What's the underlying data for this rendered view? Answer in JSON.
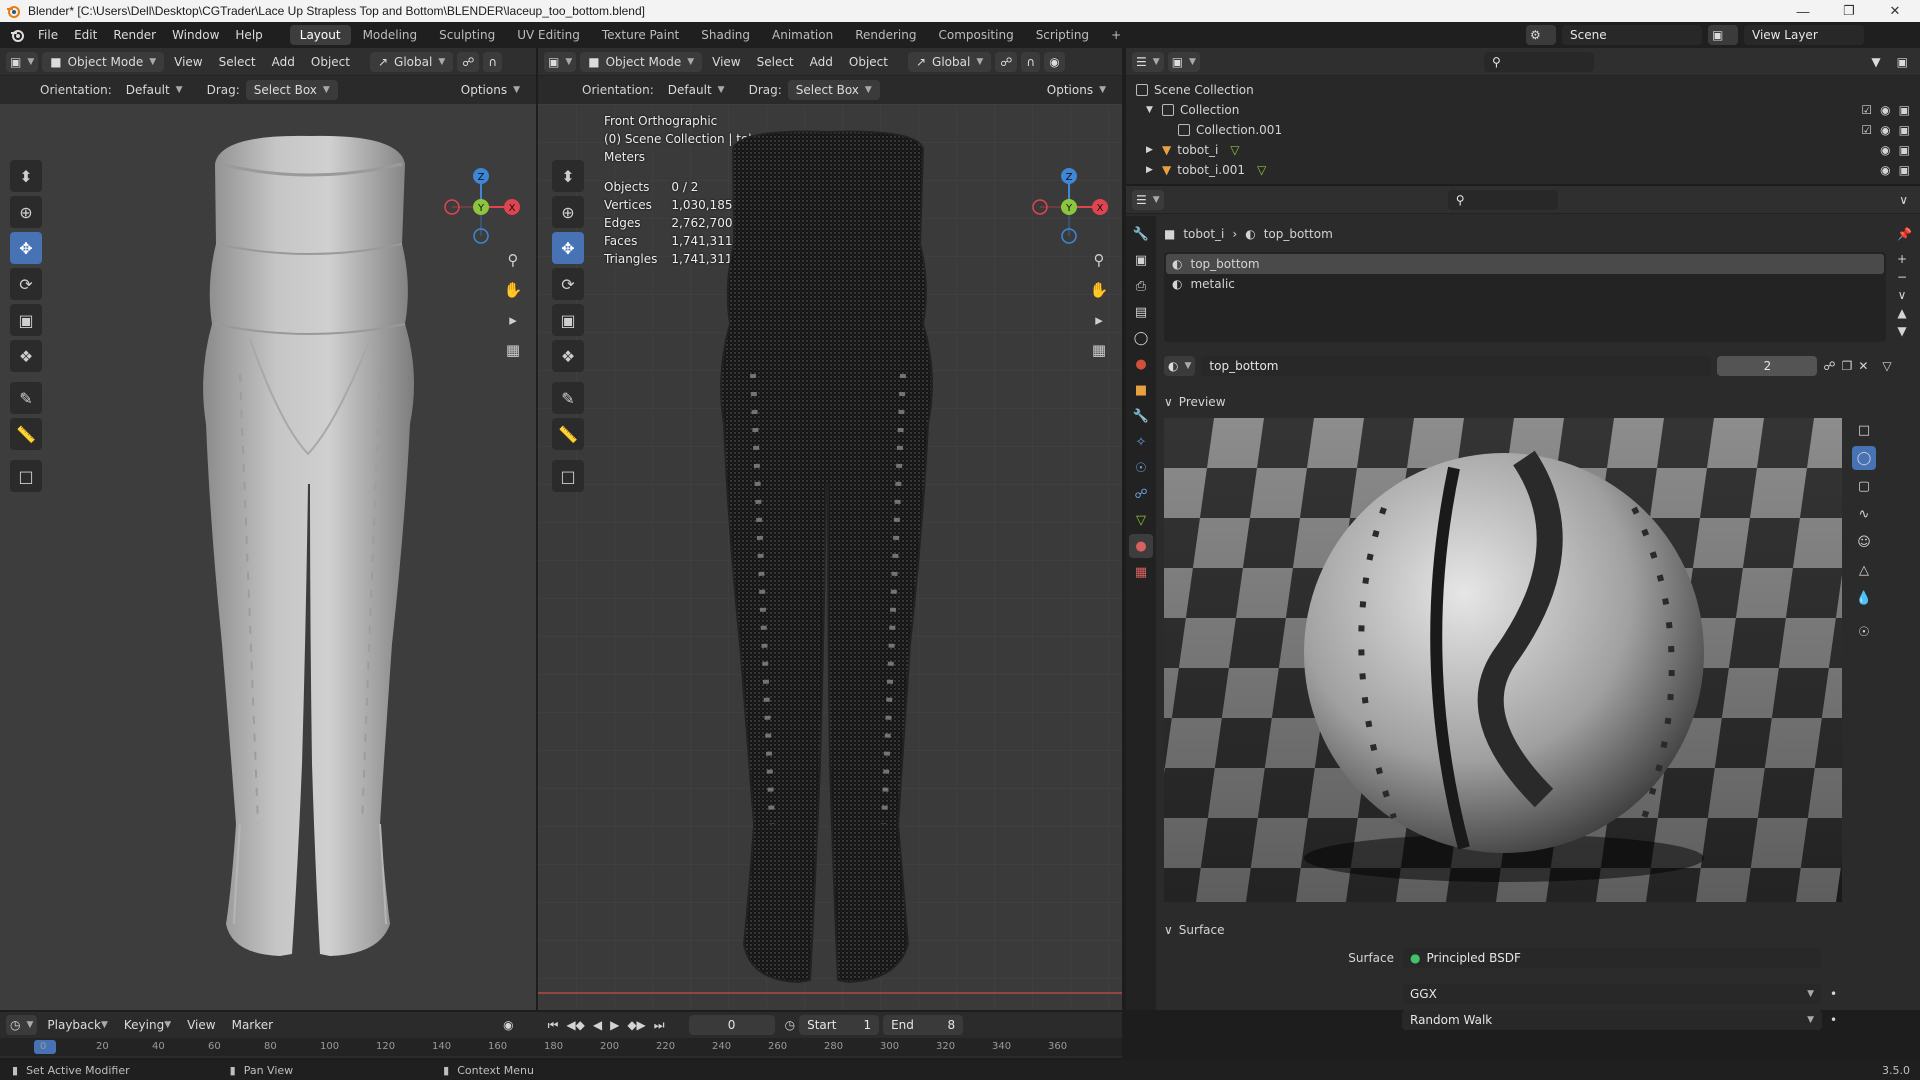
{
  "window": {
    "title": "Blender* [C:\\Users\\Dell\\Desktop\\CGTrader\\Lace Up Strapless Top and Bottom\\BLENDER\\laceup_too_bottom.blend]"
  },
  "menu": [
    "File",
    "Edit",
    "Render",
    "Window",
    "Help"
  ],
  "workspaces": [
    "Layout",
    "Modeling",
    "Sculpting",
    "UV Editing",
    "Texture Paint",
    "Shading",
    "Animation",
    "Rendering",
    "Compositing",
    "Scripting"
  ],
  "scene": {
    "label": "Scene",
    "view_layer": "View Layer"
  },
  "viewport_left": {
    "mode": "Object Mode",
    "menus": [
      "View",
      "Select",
      "Add",
      "Object"
    ],
    "transform": "Global",
    "orientation_label": "Orientation:",
    "orientation": "Default",
    "drag_label": "Drag:",
    "drag": "Select Box",
    "options": "Options"
  },
  "viewport_right": {
    "mode": "Object Mode",
    "menus": [
      "View",
      "Select",
      "Add",
      "Object"
    ],
    "transform": "Global",
    "orientation_label": "Orientation:",
    "orientation": "Default",
    "drag_label": "Drag:",
    "drag": "Select Box",
    "options": "Options",
    "view_name": "Front Orthographic",
    "collection_info": "(0) Scene Collection | tobot_i",
    "units": "Meters",
    "stats": [
      {
        "label": "Objects",
        "value": "0 / 2"
      },
      {
        "label": "Vertices",
        "value": "1,030,185"
      },
      {
        "label": "Edges",
        "value": "2,762,700"
      },
      {
        "label": "Faces",
        "value": "1,741,311"
      },
      {
        "label": "Triangles",
        "value": "1,741,311"
      }
    ]
  },
  "gizmo": {
    "z": "Z",
    "y": "Y",
    "x": "X"
  },
  "outliner": {
    "root": "Scene Collection",
    "items": [
      {
        "name": "Collection",
        "depth": 1
      },
      {
        "name": "Collection.001",
        "depth": 2
      },
      {
        "name": "tobot_i",
        "depth": 1
      },
      {
        "name": "tobot_i.001",
        "depth": 1
      }
    ]
  },
  "properties": {
    "breadcrumb_object": "tobot_i",
    "breadcrumb_material": "top_bottom",
    "slots": [
      "top_bottom",
      "metalic"
    ],
    "material_name": "top_bottom",
    "user_count": "2",
    "preview_label": "Preview",
    "surface_section": "Surface",
    "surface_label": "Surface",
    "surface_value": "Principled BSDF",
    "distribution": "GGX",
    "subsurface": "Random Walk"
  },
  "timeline": {
    "menus": [
      "Playback",
      "Keying",
      "View",
      "Marker"
    ],
    "current_frame": "0",
    "start_label": "Start",
    "start": "1",
    "end_label": "End",
    "end": "8",
    "ticks": [
      "0",
      "20",
      "40",
      "60",
      "80",
      "100",
      "120",
      "140",
      "160",
      "180",
      "200",
      "220",
      "240",
      "260",
      "280",
      "300",
      "320",
      "340",
      "360"
    ]
  },
  "statusbar": {
    "left": "Set Active Modifier",
    "middle": "Pan View",
    "right": "Context Menu",
    "version": "3.5.0"
  },
  "colors": {
    "accent": "#4772b3",
    "axis_x": "#e04450",
    "axis_y": "#8cc63e",
    "axis_z": "#3e86d6"
  }
}
